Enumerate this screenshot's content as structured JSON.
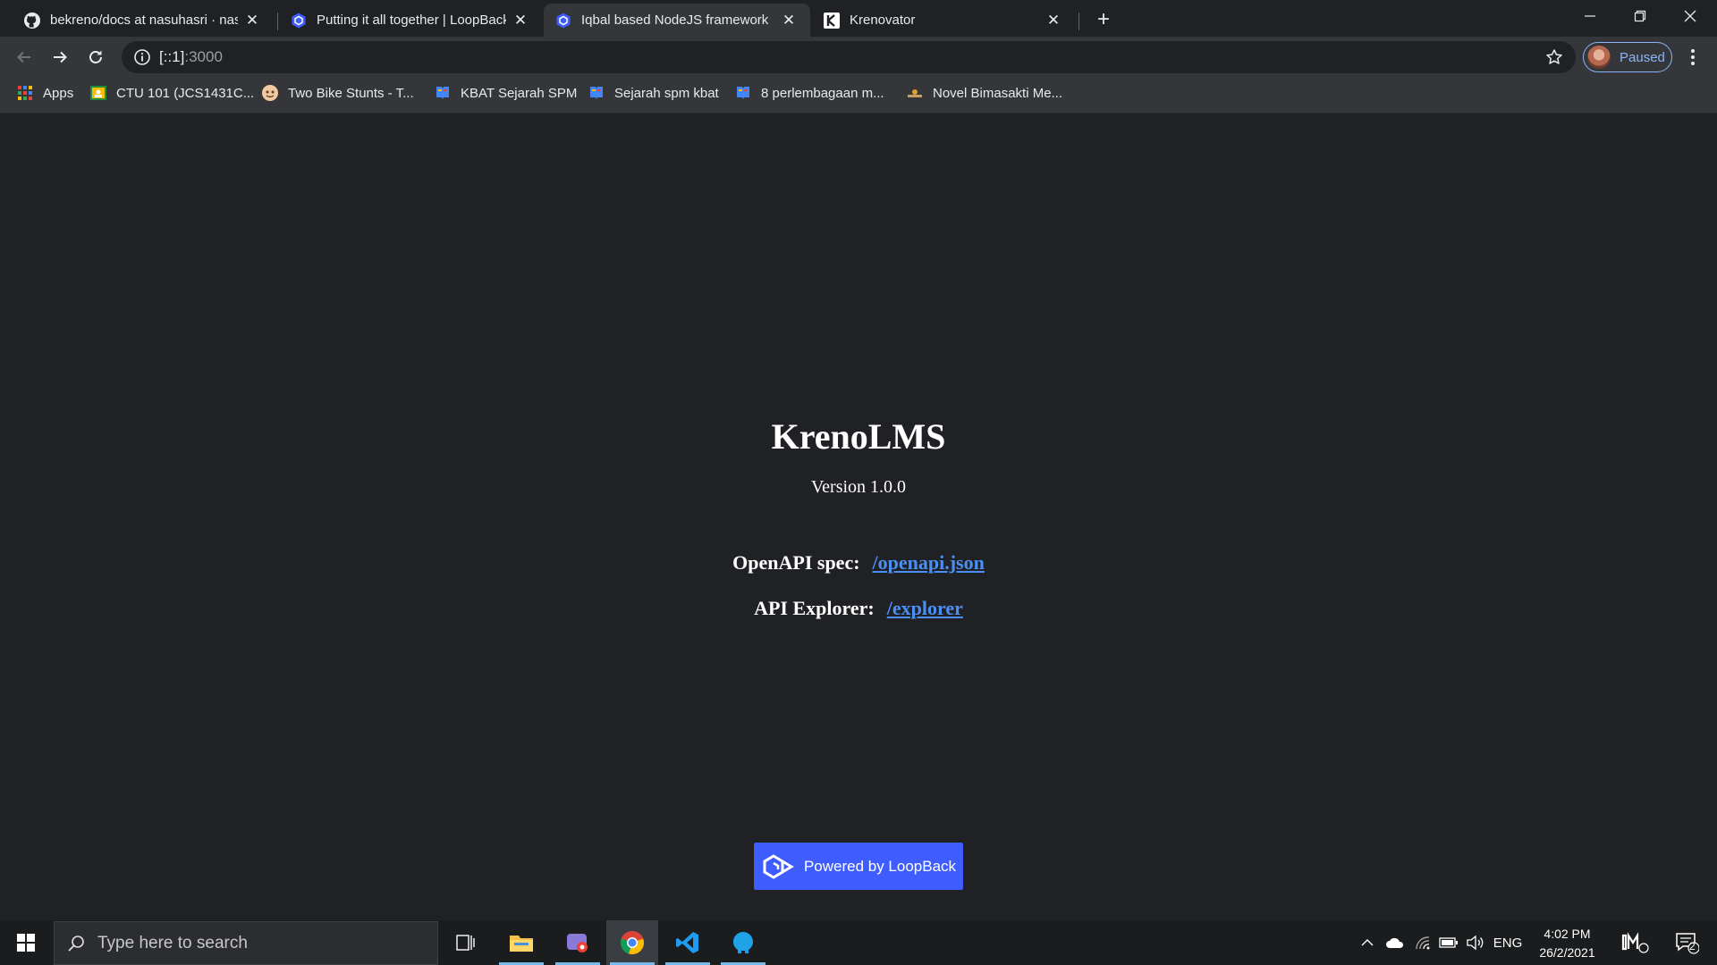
{
  "browser": {
    "tabs": [
      {
        "title": "bekreno/docs at nasuhasri · nasu",
        "icon": "github-icon"
      },
      {
        "title": "Putting it all together | LoopBack",
        "icon": "loopback-icon"
      },
      {
        "title": "Iqbal based NodeJS framework",
        "icon": "loopback-icon",
        "active": true
      },
      {
        "title": "Krenovator",
        "icon": "krenovator-icon"
      }
    ],
    "url_host": "[::1]",
    "url_port": ":3000",
    "profile_label": "Paused"
  },
  "bookmarks": [
    {
      "label": "Apps",
      "icon": "apps-grid-icon"
    },
    {
      "label": "CTU 101 (JCS1431C...",
      "icon": "classroom-icon"
    },
    {
      "label": "Two Bike Stunts - T...",
      "icon": "bike-favicon-icon"
    },
    {
      "label": "KBAT Sejarah SPM",
      "icon": "book-favicon-icon"
    },
    {
      "label": "Sejarah spm kbat",
      "icon": "book-favicon-icon"
    },
    {
      "label": "8 perlembagaan m...",
      "icon": "book-favicon-icon"
    },
    {
      "label": "Novel Bimasakti Me...",
      "icon": "novel-favicon-icon"
    }
  ],
  "page": {
    "title": "KrenoLMS",
    "version": "Version 1.0.0",
    "openapi_label": "OpenAPI spec:",
    "openapi_link": "/openapi.json",
    "explorer_label": "API Explorer:",
    "explorer_link": "/explorer",
    "powered_by": "Powered by LoopBack"
  },
  "taskbar": {
    "search_placeholder": "Type here to search",
    "language": "ENG",
    "time": "4:02 PM",
    "date": "26/2/2021",
    "notification_count": "2"
  },
  "colors": {
    "page_bg": "#202124",
    "link": "#4c8ff4",
    "loopback_blue": "#3f5dff",
    "profile_accent": "#8ab4f8"
  }
}
